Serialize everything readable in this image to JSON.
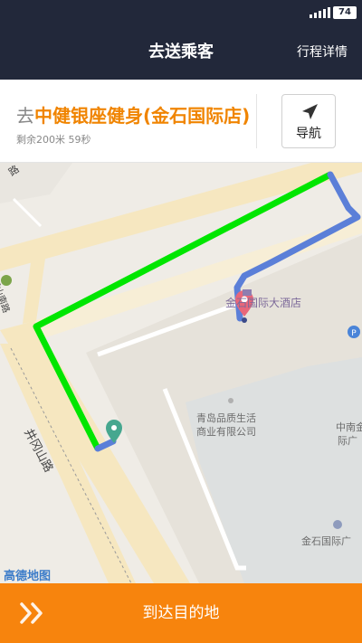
{
  "status_bar": {
    "battery": "74"
  },
  "nav": {
    "title": "去送乘客",
    "right_link": "行程详情"
  },
  "destination": {
    "prefix": "去",
    "name": "中健银座健身(金石国际店)",
    "meta": "剩余200米 59秒",
    "navigate_label": "导航"
  },
  "map": {
    "hotel": "金石国际大酒店",
    "company_line1": "青岛品质生活",
    "company_line2": "商业有限公司",
    "side_label_1": "中南金",
    "side_label_2": "际广",
    "bottom_right": "金石国际广",
    "road_1": "井冈山路",
    "road_2": "江山南路",
    "road_3": "路",
    "logo": "高德地图",
    "colors": {
      "route_done": "#00e600",
      "route_remaining": "#5b7fd8",
      "pin_destination": "#e8677a",
      "pin_start": "#46a78f"
    }
  },
  "action": {
    "arrive_label": "到达目的地"
  }
}
